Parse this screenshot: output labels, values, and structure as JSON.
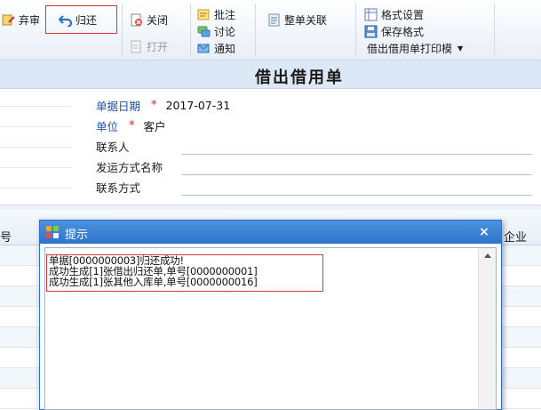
{
  "toolbar": {
    "abandon_label": "弃审",
    "return_label": "归还",
    "close_label": "关闭",
    "open_label": "打开",
    "annotate_label": "批注",
    "discuss_label": "讨论",
    "notify_label": "通知",
    "whole_link_label": "整单关联",
    "format_settings_label": "格式设置",
    "save_format_label": "保存格式",
    "print_template_label": "借出借用单打印模"
  },
  "form": {
    "title": "借出借用单",
    "fields": [
      {
        "label": "单据日期",
        "required": "*",
        "value": "2017-07-31"
      },
      {
        "label": "单位",
        "required": "*",
        "value": "客户"
      },
      {
        "label": "联系人",
        "value": ""
      },
      {
        "label": "发运方式名称",
        "value": ""
      },
      {
        "label": "联系方式",
        "value": ""
      }
    ]
  },
  "grid": {
    "header_left": "号",
    "header_right": "企业"
  },
  "dialog": {
    "title": "提示",
    "close_symbol": "×",
    "messages": [
      "单据[0000000003]归还成功!",
      "成功生成[1]张借出归还单,单号[0000000001]",
      "成功生成[1]张其他入库单,单号[0000000016]"
    ]
  },
  "colors": {
    "accent": "#2e74cc",
    "highlight_border": "#e03030",
    "required": "#d9242b"
  }
}
